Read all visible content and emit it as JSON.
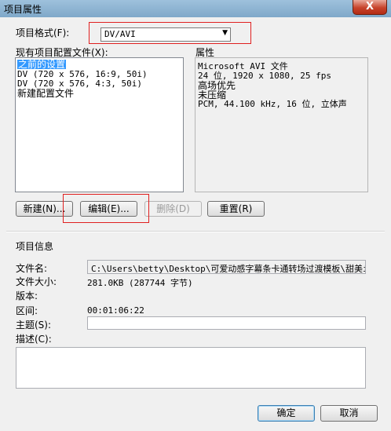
{
  "window": {
    "title": "项目属性",
    "close_label": "X"
  },
  "format": {
    "label": "项目格式(F):",
    "value": "DV/AVI",
    "arrow": "▼"
  },
  "presets": {
    "label": "现有项目配置文件(X):",
    "items": [
      {
        "label": "之前的设置",
        "selected": true
      },
      {
        "label": "DV (720 x 576, 16:9, 50i)",
        "selected": false
      },
      {
        "label": "DV (720 x 576, 4:3, 50i)",
        "selected": false
      },
      {
        "label": "新建配置文件",
        "selected": false
      }
    ]
  },
  "properties": {
    "label": "属性",
    "lines": [
      "Microsoft AVI 文件",
      "24 位, 1920 x 1080, 25 fps",
      "高场优先",
      "未压缩",
      "PCM, 44.100 kHz, 16 位, 立体声"
    ]
  },
  "buttons": {
    "new": "新建(N)...",
    "edit": "编辑(E)...",
    "delete": "删除(D)",
    "reset": "重置(R)",
    "ok": "确定",
    "cancel": "取消"
  },
  "info": {
    "heading": "项目信息",
    "filename_label": "文件名:",
    "filename_value": "C:\\Users\\betty\\Desktop\\可爱动感字幕条卡通转场过渡模板\\甜美i",
    "filesize_label": "文件大小:",
    "filesize_value": "281.0KB (287744 字节)",
    "version_label": "版本:",
    "range_label": "区间:",
    "range_value": "00:01:06:22",
    "subject_label": "主题(S):",
    "subject_value": "",
    "desc_label": "描述(C):",
    "desc_value": ""
  },
  "colors": {
    "highlight": "#e02020",
    "selection": "#3399ff"
  }
}
